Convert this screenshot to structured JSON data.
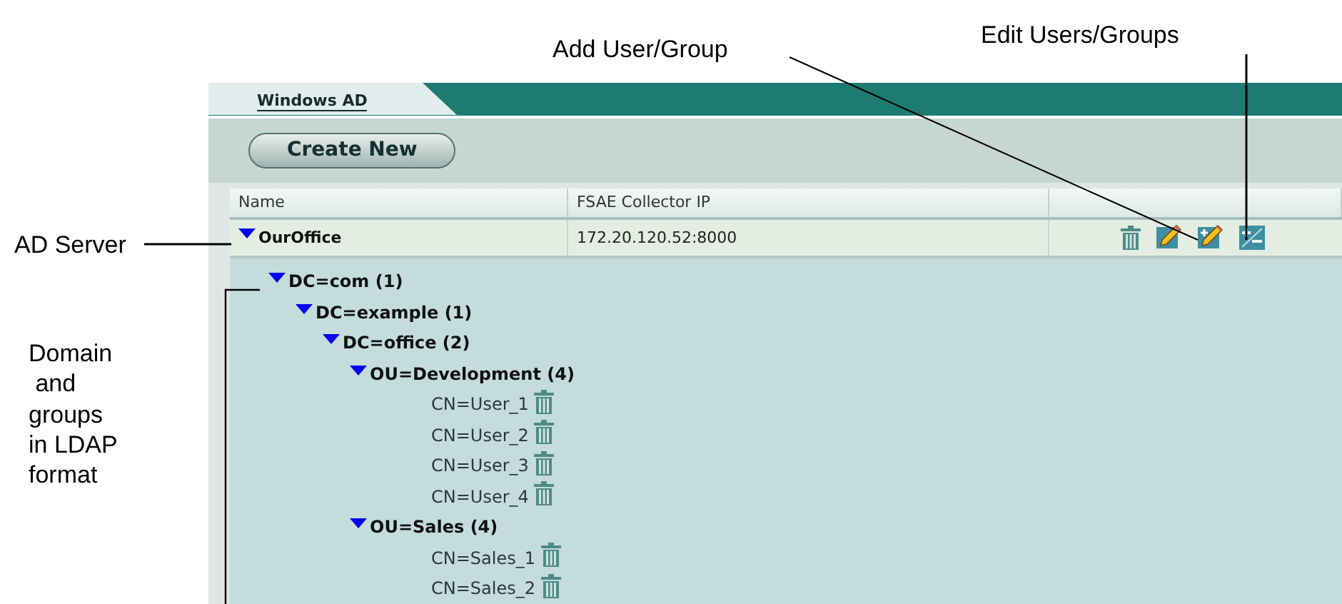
{
  "tabs": [
    {
      "label": "Windows AD",
      "selected": true
    }
  ],
  "create_button": "Create New",
  "table": {
    "columns": [
      "Name",
      "FSAE Collector IP"
    ],
    "server": {
      "name": "OurOffice",
      "ip": "172.20.120.52:8000",
      "expanded": true
    }
  },
  "tree": [
    {
      "label": "DC=com (1)",
      "expanded": true,
      "children": [
        {
          "label": "DC=example (1)",
          "expanded": true,
          "children": [
            {
              "label": "DC=office (2)",
              "expanded": true,
              "children": [
                {
                  "label": "OU=Development (4)",
                  "expanded": true,
                  "children": [
                    {
                      "label": "CN=User_1"
                    },
                    {
                      "label": "CN=User_2"
                    },
                    {
                      "label": "CN=User_3"
                    },
                    {
                      "label": "CN=User_4"
                    }
                  ]
                },
                {
                  "label": "OU=Sales (4)",
                  "expanded": true,
                  "children": [
                    {
                      "label": "CN=Sales_1"
                    },
                    {
                      "label": "CN=Sales_2"
                    }
                  ]
                }
              ]
            }
          ]
        }
      ]
    }
  ],
  "callouts": {
    "add_user_group": "Add User/Group",
    "edit_users_groups": "Edit Users/Groups",
    "ad_server": "AD Server",
    "domain_groups": "Domain\n and\ngroups\nin LDAP\nformat"
  }
}
